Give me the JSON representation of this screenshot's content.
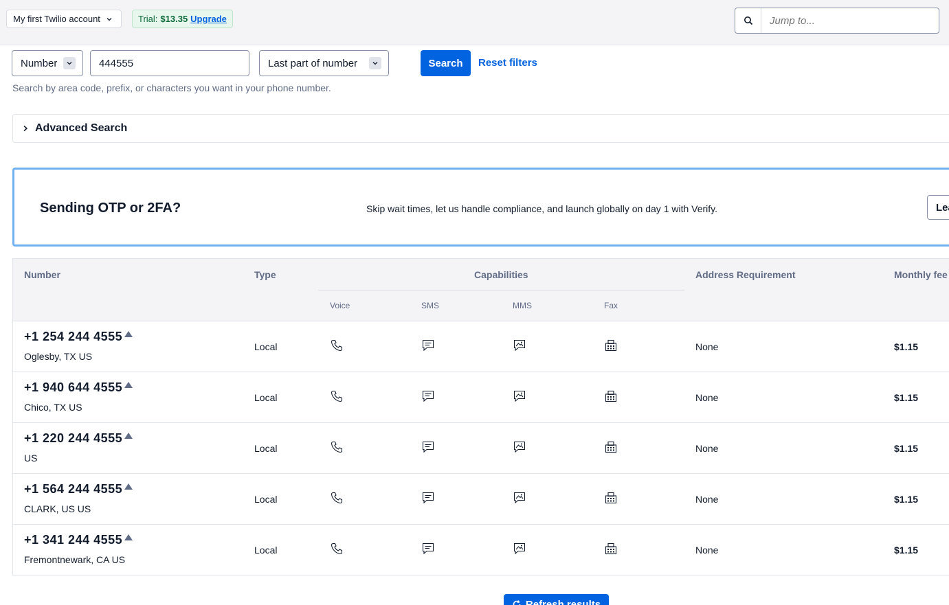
{
  "topbar": {
    "account_label": "My first Twilio account",
    "trial_label": "Trial:",
    "trial_amount": "$13.35",
    "upgrade_label": "Upgrade",
    "jump_placeholder": "Jump to..."
  },
  "filters": {
    "search_by": "Number",
    "number_value": "444555",
    "match_mode": "Last part of number",
    "search_button": "Search",
    "reset_link": "Reset filters",
    "help_text": "Search by area code, prefix, or characters you want in your phone number."
  },
  "advanced": {
    "label": "Advanced Search"
  },
  "banner": {
    "heading": "Sending OTP or 2FA?",
    "body": "Skip wait times, let us handle compliance, and launch globally on day 1 with Verify.",
    "button": "Lea"
  },
  "table": {
    "headers": {
      "number": "Number",
      "type": "Type",
      "capabilities": "Capabilities",
      "voice": "Voice",
      "sms": "SMS",
      "mms": "MMS",
      "fax": "Fax",
      "address": "Address Requirement",
      "fee": "Monthly fee"
    },
    "rows": [
      {
        "number": "+1 254 244 4555",
        "location": "Oglesby, TX US",
        "type": "Local",
        "address": "None",
        "fee": "$1.15"
      },
      {
        "number": "+1 940 644 4555",
        "location": "Chico, TX US",
        "type": "Local",
        "address": "None",
        "fee": "$1.15"
      },
      {
        "number": "+1 220 244 4555",
        "location": "US",
        "type": "Local",
        "address": "None",
        "fee": "$1.15"
      },
      {
        "number": "+1 564 244 4555",
        "location": "CLARK, US US",
        "type": "Local",
        "address": "None",
        "fee": "$1.15"
      },
      {
        "number": "+1 341 244 4555",
        "location": "Fremontnewark, CA US",
        "type": "Local",
        "address": "None",
        "fee": "$1.15"
      }
    ]
  },
  "footer": {
    "refresh_label": "Refresh results"
  },
  "icons": {
    "search": "search-icon",
    "chevron": "chevron-down-icon",
    "chevron_right": "chevron-right-icon",
    "voice": "phone-icon",
    "sms": "message-icon",
    "mms": "image-message-icon",
    "fax": "fax-icon",
    "refresh": "refresh-icon"
  },
  "colors": {
    "primary": "#0263e0",
    "banner_border": "#6fb1f2",
    "trial_bg": "#e8f7ee"
  }
}
